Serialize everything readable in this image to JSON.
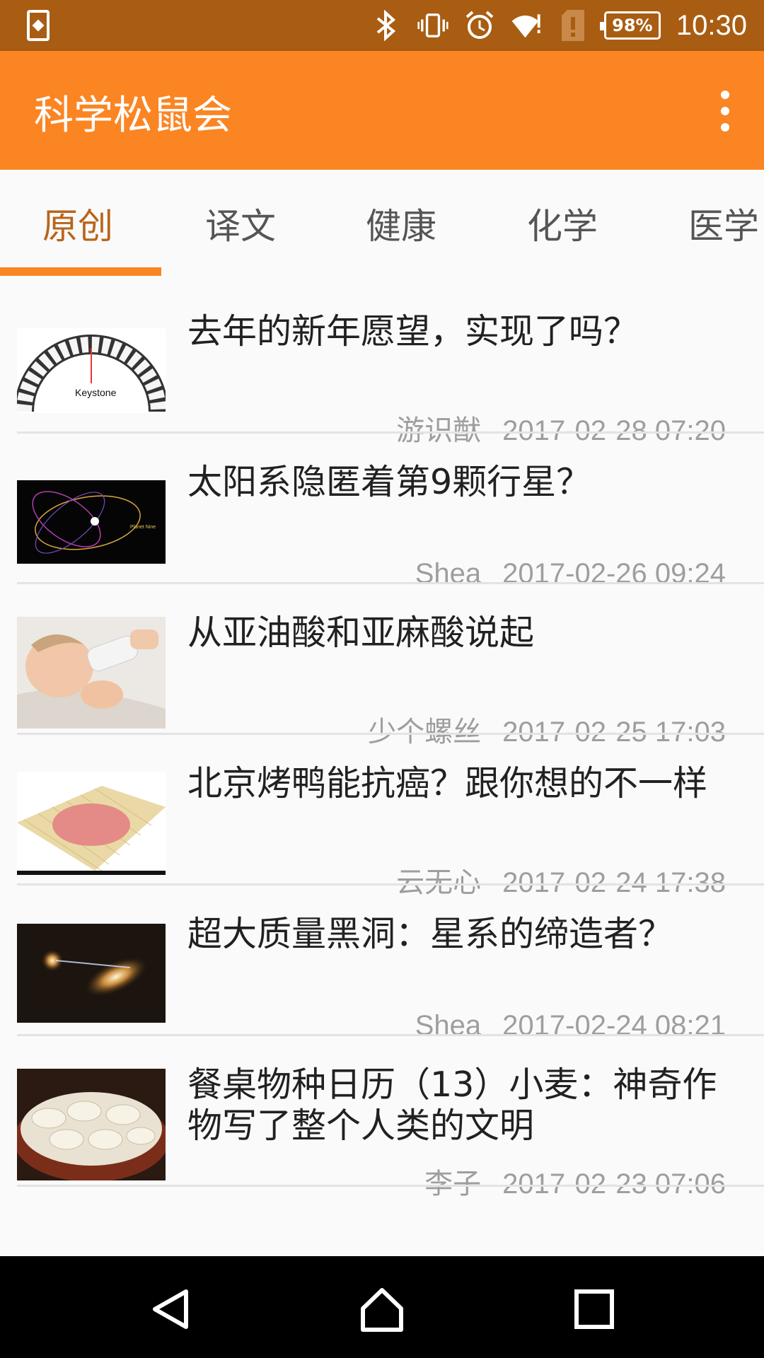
{
  "status_bar": {
    "time": "10:30",
    "battery": "98%",
    "icons": [
      "sim-card-icon",
      "bluetooth-icon",
      "vibrate-icon",
      "alarm-icon",
      "wifi-icon",
      "sd-card-alert-icon",
      "battery-icon"
    ]
  },
  "app_bar": {
    "title": "科学松鼠会",
    "menu_icon": "more-vert-icon"
  },
  "tabs": [
    {
      "label": "原创",
      "active": true
    },
    {
      "label": "译文",
      "active": false
    },
    {
      "label": "健康",
      "active": false
    },
    {
      "label": "化学",
      "active": false
    },
    {
      "label": "医学",
      "active": false
    }
  ],
  "articles": [
    {
      "title": "去年的新年愿望，实现了吗？",
      "author": "游识猷",
      "date": "2017-02-28 07:20",
      "thumb_label": "Keystone"
    },
    {
      "title": "太阳系隐匿着第9颗行星？",
      "author": "Shea",
      "date": "2017-02-26 09:24",
      "thumb_label": "Planet Nine"
    },
    {
      "title": "从亚油酸和亚麻酸说起",
      "author": "少个螺丝",
      "date": "2017-02-25 17:03"
    },
    {
      "title": "北京烤鸭能抗癌？跟你想的不一样",
      "author": "云无心",
      "date": "2017-02-24 17:38"
    },
    {
      "title": "超大质量黑洞：星系的缔造者？",
      "author": "Shea",
      "date": "2017-02-24 08:21"
    },
    {
      "title": "餐桌物种日历（13）小麦：神奇作物写了整个人类的文明",
      "author": "李子",
      "date": "2017-02-23 07:06"
    }
  ],
  "nav_bar": {
    "icons": [
      "back-icon",
      "home-icon",
      "recents-icon"
    ]
  }
}
